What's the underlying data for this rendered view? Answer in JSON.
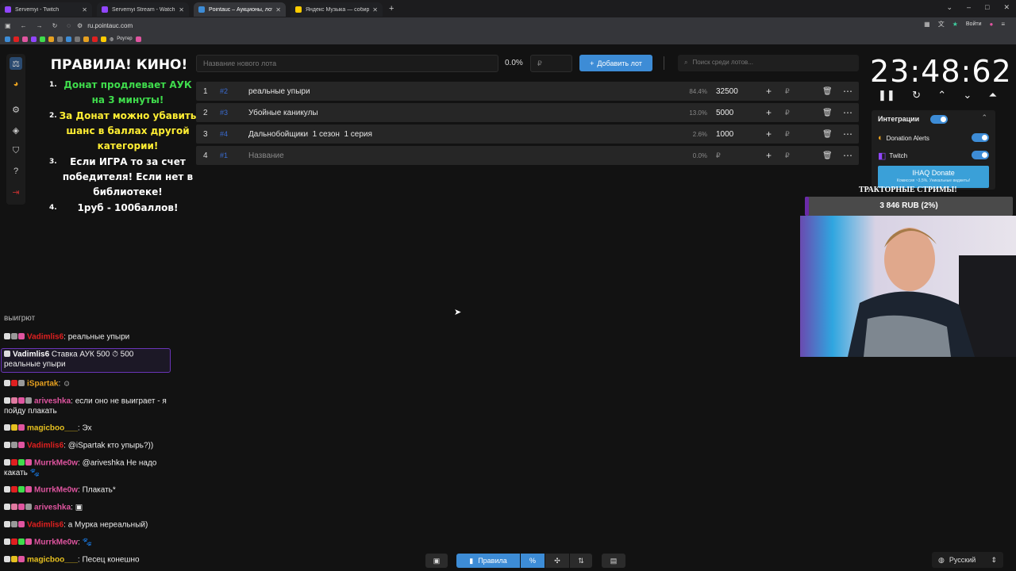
{
  "browser": {
    "tabs": [
      {
        "title": "Servemyi - Twitch",
        "active": false,
        "icon_color": "#9146ff"
      },
      {
        "title": "Servemyi Stream - Watch Live",
        "active": false,
        "icon_color": "#9146ff"
      },
      {
        "title": "Pointauc – Аукционы, лотереи",
        "active": true,
        "icon_color": "#3d8cd6"
      },
      {
        "title": "Яндекс Музыка — собираем",
        "active": false,
        "icon_color": "#ffcc00"
      }
    ],
    "url": "ru.pointauc.com",
    "login_label": "Войти",
    "bookmark_label": "Роутер"
  },
  "rules": {
    "title": "ПРАВИЛА! КИНО!",
    "items": [
      {
        "num": "1.",
        "text": "Донат продлевает АУК на 3 минуты!",
        "color": "#3fdc4c"
      },
      {
        "num": "2.",
        "text": "За Донат можно убавить шанс в баллах другой категории!",
        "color": "#ffee33"
      },
      {
        "num": "3.",
        "text": "Если ИГРА то за счет победителя! Если нет в библиотеке!",
        "color": "#ffffff"
      },
      {
        "num": "4.",
        "text": "1руб - 100баллов!",
        "color": "#ffffff"
      }
    ]
  },
  "controls": {
    "new_lot_placeholder": "Название нового лота",
    "percent": "0.0%",
    "amount_placeholder": "₽",
    "add_lot_label": "Добавить лот",
    "search_placeholder": "Поиск среди лотов..."
  },
  "lots": [
    {
      "index": "1",
      "code": "#2",
      "name": "реальные упыри",
      "percent": "84.4%",
      "amount": "32500",
      "placeholder": false
    },
    {
      "index": "2",
      "code": "#3",
      "name": "Убойные каникулы",
      "percent": "13.0%",
      "amount": "5000",
      "placeholder": false
    },
    {
      "index": "3",
      "code": "#4",
      "name": "Дальнобойщики  1 сезон  1 серия",
      "percent": "2.6%",
      "amount": "1000",
      "placeholder": false
    },
    {
      "index": "4",
      "code": "#1",
      "name": "Название",
      "percent": "0.0%",
      "amount": "₽",
      "placeholder": true
    }
  ],
  "timer": {
    "value": "23:48:62"
  },
  "integrations": {
    "title": "Интеграции",
    "items": [
      {
        "name": "Donation Alerts",
        "enabled": true
      },
      {
        "name": "Twitch",
        "enabled": true
      }
    ],
    "donate_button": "IHAQ Donate",
    "donate_sub": "Комиссия ~3,5%. Уникальные виджеты!"
  },
  "overlay": {
    "title": "ТРАКТОРНЫЕ СТРИМЫ!",
    "goal_text": "3 846 RUB (2%)",
    "goal_fraction": 0.02
  },
  "chat": [
    {
      "user": "",
      "user_color": "#ddd",
      "text": "выигрют",
      "highlight": false
    },
    {
      "user": "Vadimlis6",
      "user_color": "#e02020",
      "text": ": реальные упыри",
      "highlight": false
    },
    {
      "user": "Vadimlis6",
      "user_color": "#ffffff",
      "text": "Ставка АУК 500  ⏱ 500 реальные упыри",
      "highlight": true
    },
    {
      "user": "iSpartak",
      "user_color": "#e6a020",
      "text": ":",
      "highlight": false
    },
    {
      "user": "ariveshka",
      "user_color": "#e055a0",
      "text": ": если оно не выиграет - я пойду плакать",
      "highlight": false
    },
    {
      "user": "magicboo___",
      "user_color": "#e6c020",
      "text": ": Эх",
      "highlight": false
    },
    {
      "user": "Vadimlis6",
      "user_color": "#e02020",
      "text": ": @iSpartak кто упырь?))",
      "highlight": false
    },
    {
      "user": "MurrkMe0w",
      "user_color": "#e055a0",
      "text": ": @ariveshka Не надо какать",
      "highlight": false
    },
    {
      "user": "MurrkMe0w",
      "user_color": "#e055a0",
      "text": ": Плакать*",
      "highlight": false
    },
    {
      "user": "ariveshka",
      "user_color": "#e055a0",
      "text": ":",
      "highlight": false
    },
    {
      "user": "Vadimlis6",
      "user_color": "#e02020",
      "text": ": а Мурка нереальный)",
      "highlight": false
    },
    {
      "user": "MurrkMe0w",
      "user_color": "#e055a0",
      "text": ":",
      "highlight": false
    },
    {
      "user": "magicboo___",
      "user_color": "#e6c020",
      "text": ": Песец конешно",
      "highlight": false
    }
  ],
  "bottombar": {
    "rules_label": "Правила"
  },
  "language": "Русский"
}
